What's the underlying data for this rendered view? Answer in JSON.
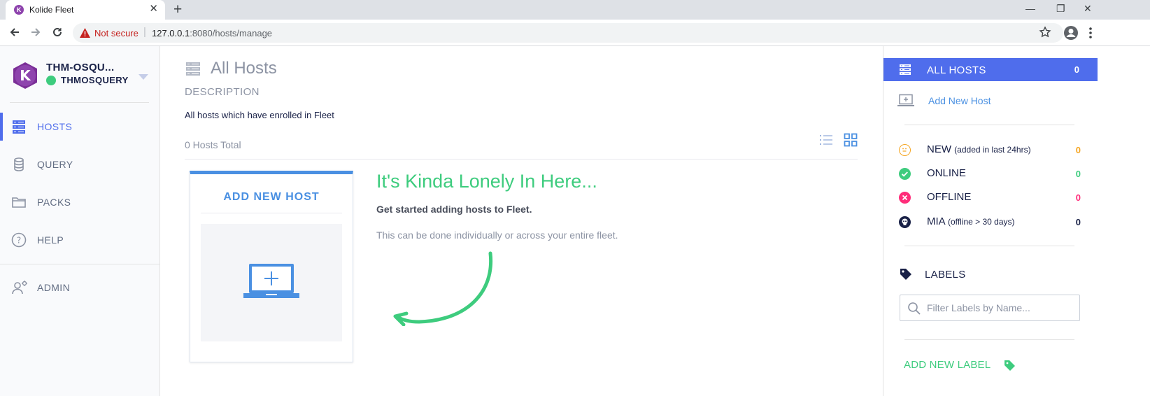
{
  "browser": {
    "tab_title": "Kolide Fleet",
    "tab_favicon_letter": "K",
    "security_label": "Not secure",
    "url_host": "127.0.0.1",
    "url_rest": ":8080/hosts/manage"
  },
  "sidebar": {
    "org_name": "THM-OSQU...",
    "username": "THMOSQUERY",
    "logo_letter": "K",
    "items": [
      {
        "label": "HOSTS",
        "icon": "hosts-icon",
        "active": true
      },
      {
        "label": "QUERY",
        "icon": "database-icon"
      },
      {
        "label": "PACKS",
        "icon": "folder-icon"
      },
      {
        "label": "HELP",
        "icon": "help-icon"
      },
      {
        "label": "ADMIN",
        "icon": "admin-icon"
      }
    ]
  },
  "main": {
    "title": "All Hosts",
    "description_heading": "DESCRIPTION",
    "description": "All hosts which have enrolled in Fleet",
    "hosts_total": "0 Hosts Total",
    "add_card_title": "ADD NEW HOST",
    "empty_heading": "It's Kinda Lonely In Here...",
    "empty_sub": "Get started adding hosts to Fleet.",
    "empty_hint": "This can be done individually or across your entire fleet."
  },
  "right_panel": {
    "all_hosts_label": "ALL HOSTS",
    "all_hosts_count": "0",
    "add_new_host": "Add New Host",
    "statuses": [
      {
        "label": "NEW",
        "sub": "(added in last 24hrs)",
        "count": "0",
        "color": "#f5a623"
      },
      {
        "label": "ONLINE",
        "sub": "",
        "count": "0",
        "color": "#3ecc7e"
      },
      {
        "label": "OFFLINE",
        "sub": "",
        "count": "0",
        "color": "#ff2d7a"
      },
      {
        "label": "MIA",
        "sub": "(offline > 30 days)",
        "count": "0",
        "color": "#192147"
      }
    ],
    "labels_heading": "LABELS",
    "filter_placeholder": "Filter Labels by Name...",
    "add_new_label": "ADD NEW LABEL"
  },
  "colors": {
    "accent": "#4f6dec",
    "link": "#4a90e2",
    "success": "#3ecc7e",
    "text_dark": "#192147",
    "muted": "#8c93a3"
  }
}
